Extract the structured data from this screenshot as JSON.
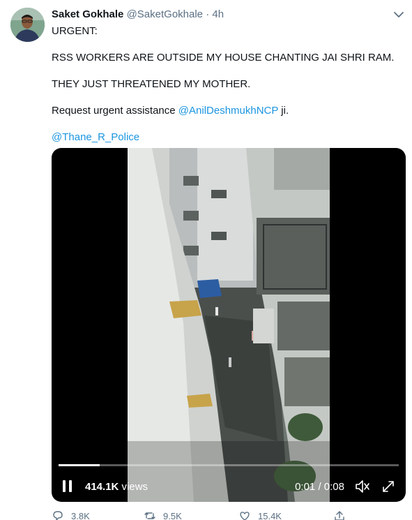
{
  "tweet": {
    "author_name": "Saket Gokhale",
    "author_handle": "@SaketGokhale",
    "separator": "·",
    "timestamp": "4h",
    "lines": {
      "l1": "URGENT:",
      "l2": "RSS WORKERS ARE OUTSIDE MY HOUSE CHANTING JAI SHRI RAM.",
      "l3": "THEY JUST THREATENED MY MOTHER.",
      "l4_prefix": "Request urgent assistance ",
      "l4_mention": "@AnilDeshmukhNCP",
      "l4_suffix": " ji.",
      "l5_mention": "@Thane_R_Police"
    }
  },
  "video": {
    "views_count": "414.1K",
    "views_label": " views",
    "current_time": "0:01",
    "time_separator": " / ",
    "duration": "0:08",
    "progress_fraction": 0.12
  },
  "actions": {
    "reply_count": "3.8K",
    "retweet_count": "9.5K",
    "like_count": "15.4K"
  },
  "colors": {
    "link": "#1b95e0",
    "secondary_text": "#5b7083",
    "video_bg": "#000000"
  },
  "icons": [
    "chevron-down-icon",
    "pause-icon",
    "mute-icon",
    "expand-icon",
    "reply-icon",
    "retweet-icon",
    "like-icon",
    "share-icon"
  ]
}
